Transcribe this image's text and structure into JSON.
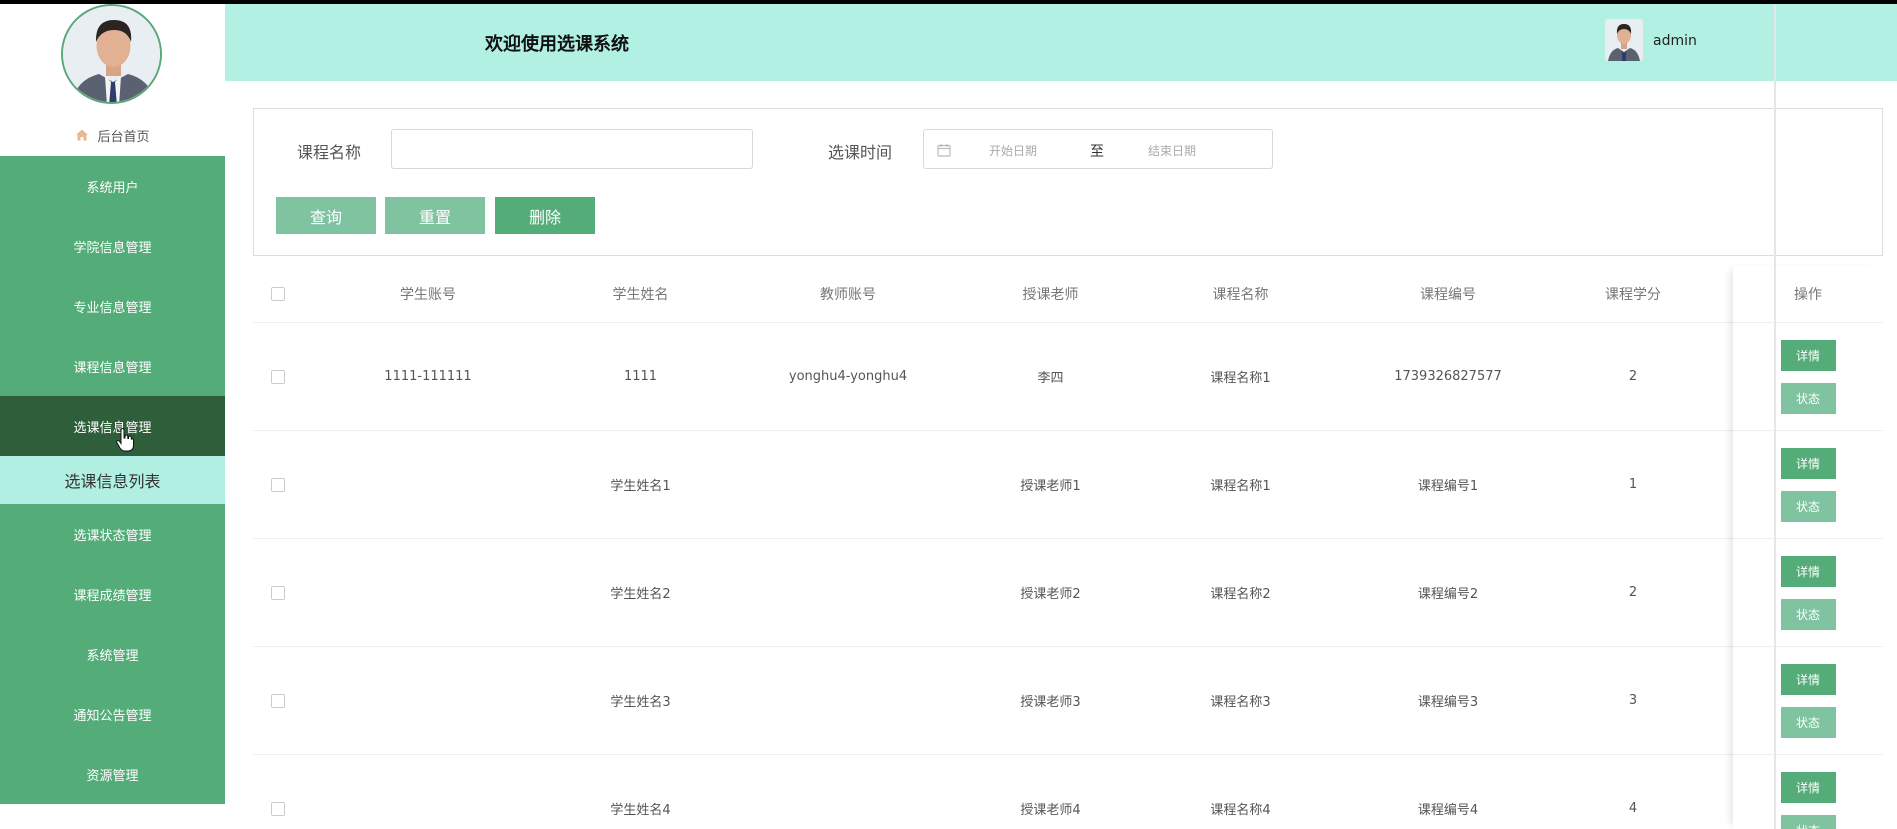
{
  "sidebar": {
    "home_label": "后台首页",
    "menu": [
      {
        "label": "系统用户"
      },
      {
        "label": "学院信息管理"
      },
      {
        "label": "专业信息管理"
      },
      {
        "label": "课程信息管理"
      },
      {
        "label": "选课信息管理",
        "active": true
      },
      {
        "label": "选课状态管理"
      },
      {
        "label": "课程成绩管理"
      },
      {
        "label": "系统管理"
      },
      {
        "label": "通知公告管理"
      },
      {
        "label": "资源管理"
      }
    ],
    "submenu_active": "选课信息列表"
  },
  "header": {
    "title": "欢迎使用选课系统",
    "username": "admin"
  },
  "search": {
    "course_name_label": "课程名称",
    "course_name_value": "",
    "time_label": "选课时间",
    "start_placeholder": "开始日期",
    "separator": "至",
    "end_placeholder": "结束日期",
    "btn_search": "查询",
    "btn_reset": "重置",
    "btn_delete": "删除"
  },
  "table": {
    "columns": [
      "学生账号",
      "学生姓名",
      "教师账号",
      "授课老师",
      "课程名称",
      "课程编号",
      "课程学分",
      "操作"
    ],
    "rows": [
      {
        "student_account": "1111-111111",
        "student_name": "1111",
        "teacher_account": "yonghu4-yonghu4",
        "teacher": "李四",
        "course_name": "课程名称1",
        "course_no": "1739326827577",
        "credit": "2"
      },
      {
        "student_account": "",
        "student_name": "学生姓名1",
        "teacher_account": "",
        "teacher": "授课老师1",
        "course_name": "课程名称1",
        "course_no": "课程编号1",
        "credit": "1"
      },
      {
        "student_account": "",
        "student_name": "学生姓名2",
        "teacher_account": "",
        "teacher": "授课老师2",
        "course_name": "课程名称2",
        "course_no": "课程编号2",
        "credit": "2"
      },
      {
        "student_account": "",
        "student_name": "学生姓名3",
        "teacher_account": "",
        "teacher": "授课老师3",
        "course_name": "课程名称3",
        "course_no": "课程编号3",
        "credit": "3"
      },
      {
        "student_account": "",
        "student_name": "学生姓名4",
        "teacher_account": "",
        "teacher": "授课老师4",
        "course_name": "课程名称4",
        "course_no": "课程编号4",
        "credit": "4"
      }
    ],
    "btn_detail": "详情",
    "btn_status": "状态"
  }
}
